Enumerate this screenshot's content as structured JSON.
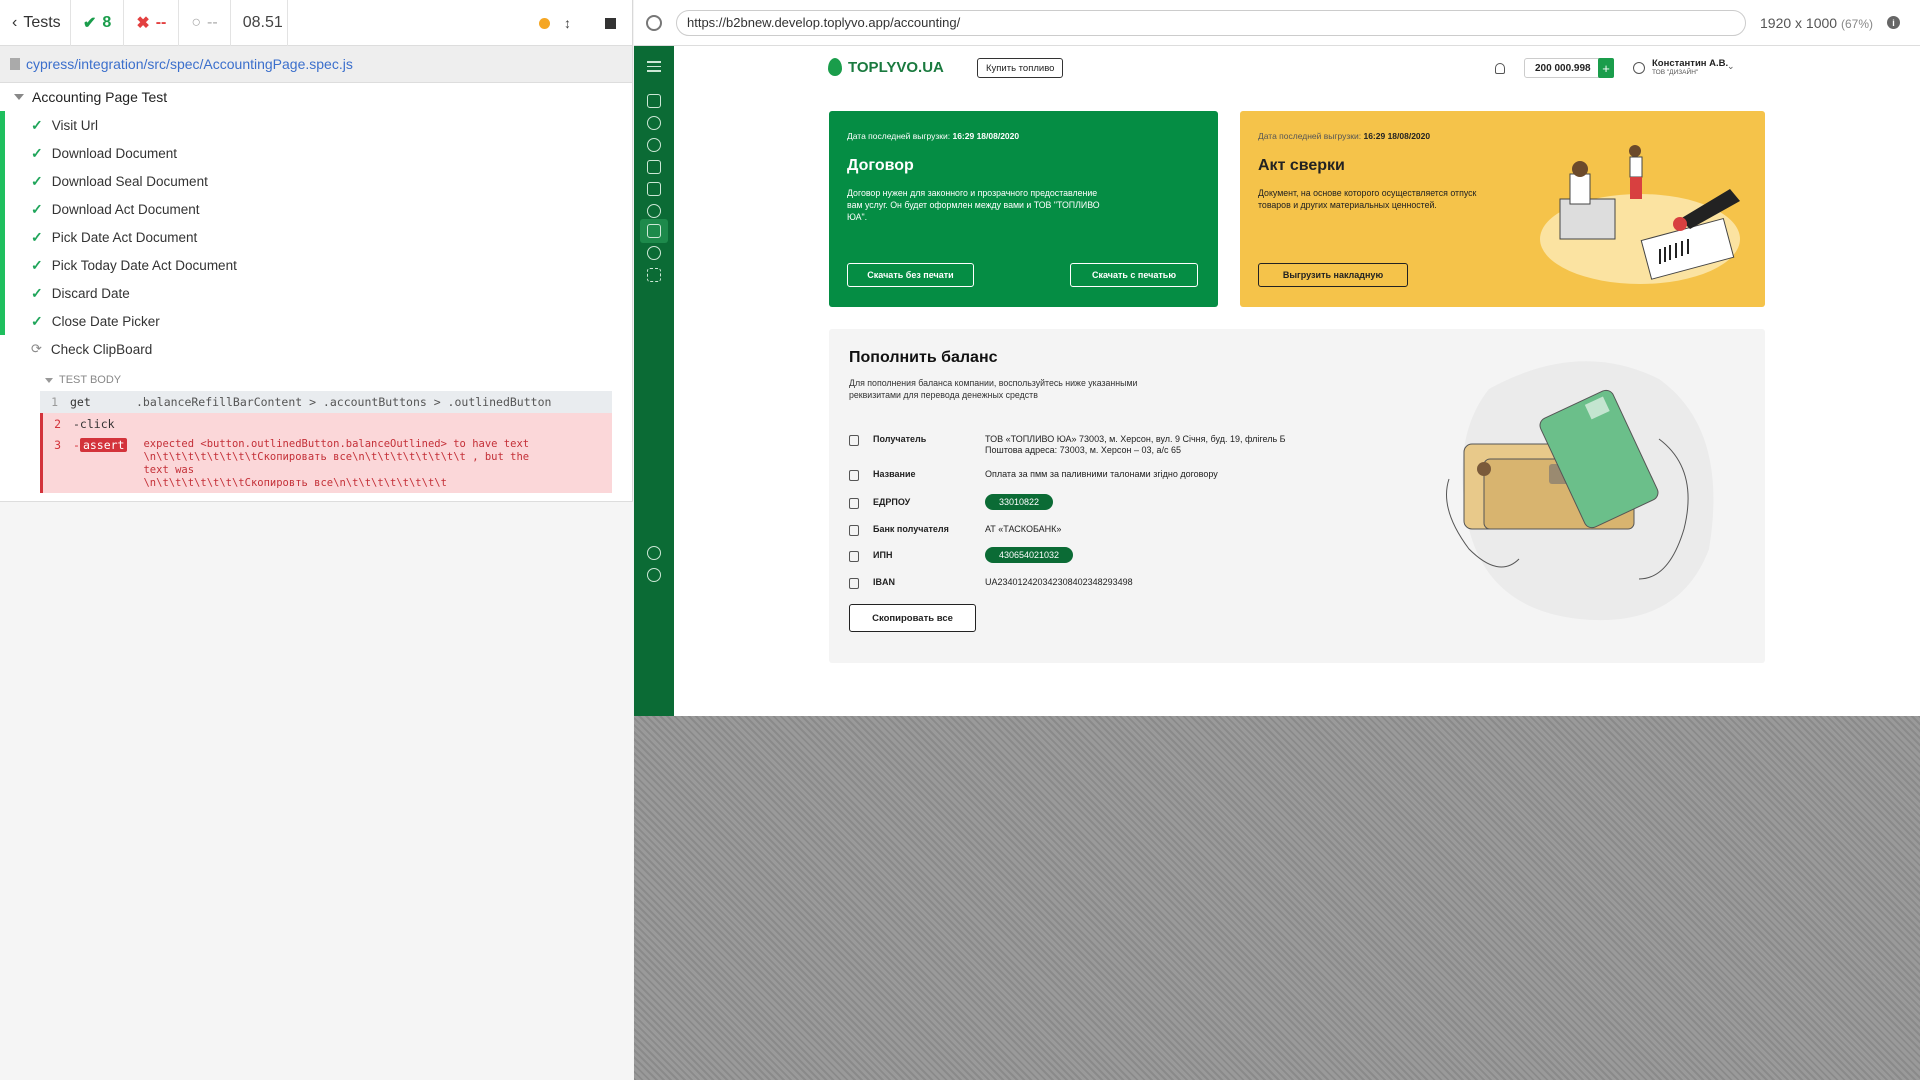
{
  "runner": {
    "tests_label": "Tests",
    "passed": "8",
    "failed": "--",
    "pending": "--",
    "duration": "08.51",
    "spec_path": "cypress/integration/src/spec/AccountingPage.spec.js",
    "suite_title": "Accounting Page Test",
    "tests": [
      {
        "label": "Visit Url"
      },
      {
        "label": "Download Document"
      },
      {
        "label": "Download Seal Document"
      },
      {
        "label": "Download Act Document"
      },
      {
        "label": "Pick Date Act Document"
      },
      {
        "label": "Pick Today Date Act Document"
      },
      {
        "label": "Discard Date"
      },
      {
        "label": "Close Date Picker"
      }
    ],
    "running_test": "Check ClipBoard",
    "test_body_label": "TEST BODY",
    "commands": [
      {
        "num": "1",
        "name": "get",
        "msg": ".balanceRefillBarContent > .accountButtons > .outlinedButton"
      },
      {
        "num": "2",
        "name": "-click",
        "msg": ""
      },
      {
        "num": "3",
        "name": "assert",
        "msg": "expected <button.outlinedButton.balanceOutlined> to have text\n\\n\\t\\t\\t\\t\\t\\t\\t\\tСкопировать все\\n\\t\\t\\t\\t\\t\\t\\t\\t , but the text was\n\\n\\t\\t\\t\\t\\t\\t\\tСкопировть все\\n\\t\\t\\t\\t\\t\\t\\t\\t"
      }
    ]
  },
  "browser": {
    "url": "https://b2bnew.develop.toplyvo.app/accounting/",
    "viewport": "1920 x 1000",
    "scale": "(67%)",
    "info": "i"
  },
  "app": {
    "logo_text": "TOPLYVO.UA",
    "buy_fuel_label": "Купить топливо",
    "balance": "200 000.998",
    "plus": "+",
    "user_name": "Константин А.В.",
    "user_company": "ТОВ \"ДИЗАЙН\"",
    "contract_card": {
      "meta_label": "Дата последней выгрузки:",
      "meta_value": "16:29 18/08/2020",
      "title": "Договор",
      "desc": "Договор нужен для законного и прозрачного предоставление вам услуг. Он будет оформлен между вами и ТОВ \"ТОПЛИВО ЮА\".",
      "btn_no_seal": "Скачать без печати",
      "btn_seal": "Скачать с печатью"
    },
    "act_card": {
      "meta_label": "Дата последней выгрузки:",
      "meta_value": "16:29 18/08/2020",
      "title": "Акт сверки",
      "desc": "Документ, на основе которого осуществляется отпуск товаров и других материальных ценностей.",
      "btn": "Выгрузить накладную"
    },
    "refill": {
      "title": "Пополнить баланс",
      "desc": "Для пополнения баланса компании, воспользуйтесь ниже указанными реквизитами для перевода денежных средств",
      "rows": [
        {
          "label": "Получатель",
          "value": "ТОВ «ТОПЛИВО ЮА» 73003, м. Херсон, вул. 9 Січня, буд. 19, флігель Б",
          "value2": "Поштова адреса: 73003, м. Херсон – 03, а/с 65"
        },
        {
          "label": "Название",
          "value": "Оплата за пмм за паливними талонами згідно договору"
        },
        {
          "label": "ЕДРПОУ",
          "value": "33010822"
        },
        {
          "label": "Банк получателя",
          "value": "АТ «ТАСКОБАНК»"
        },
        {
          "label": "ИПН",
          "value": "430654021032"
        },
        {
          "label": "IBAN",
          "value": "UA234012420342308402348293498"
        }
      ],
      "copy_all": "Скопировать все"
    }
  }
}
